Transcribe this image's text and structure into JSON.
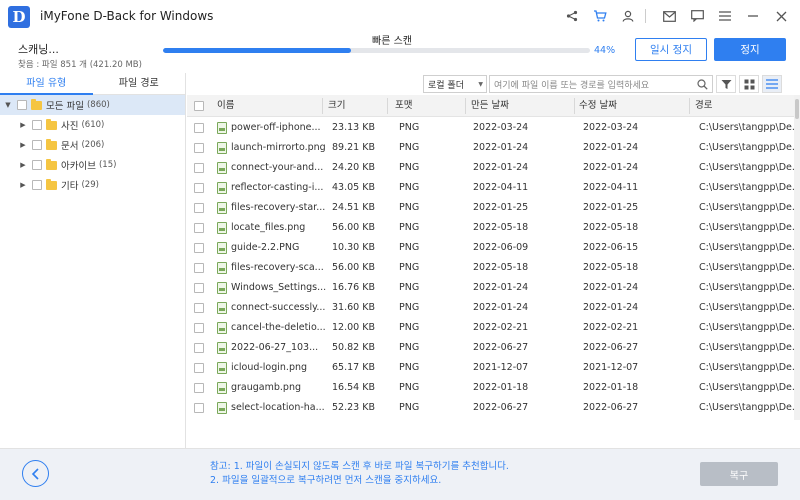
{
  "app": {
    "logo_letter": "D",
    "title": "iMyFone D-Back for Windows"
  },
  "titlebar_icons": [
    "share-icon",
    "cart-icon",
    "user-icon",
    "mail-icon",
    "feedback-icon",
    "menu-icon",
    "minimize-icon",
    "close-icon"
  ],
  "progress": {
    "status": "스캐닝...",
    "found": "찾음 : 파일 851 개 (421.20 MB)",
    "mode": "빠른 스캔",
    "percent_text": "44%",
    "percent": 44,
    "pause_label": "일시 정지",
    "stop_label": "정지"
  },
  "left": {
    "tabs": [
      "파일 유형",
      "파일 경로"
    ],
    "tree": [
      {
        "label": "모든 파일",
        "count": "(860)",
        "selected": true,
        "depth": 0
      },
      {
        "label": "사진",
        "count": "(610)",
        "selected": false,
        "depth": 1
      },
      {
        "label": "문서",
        "count": "(206)",
        "selected": false,
        "depth": 1
      },
      {
        "label": "아카이브",
        "count": "(15)",
        "selected": false,
        "depth": 1
      },
      {
        "label": "기타",
        "count": "(29)",
        "selected": false,
        "depth": 1
      }
    ]
  },
  "filter": {
    "location": "로컬 폴더",
    "search_placeholder": "여기에 파일 이름 또는 경로를 입력하세요"
  },
  "table": {
    "columns": [
      "이름",
      "크기",
      "포맷",
      "만든 날짜",
      "수정 날짜",
      "경로"
    ],
    "rows": [
      [
        "power-off-iphone...",
        "23.13 KB",
        "PNG",
        "2022-03-24",
        "2022-03-24",
        "C:\\Users\\tangpp\\De..."
      ],
      [
        "launch-mirrorto.png",
        "89.21 KB",
        "PNG",
        "2022-01-24",
        "2022-01-24",
        "C:\\Users\\tangpp\\De..."
      ],
      [
        "connect-your-and...",
        "24.20 KB",
        "PNG",
        "2022-01-24",
        "2022-01-24",
        "C:\\Users\\tangpp\\De..."
      ],
      [
        "reflector-casting-i...",
        "43.05 KB",
        "PNG",
        "2022-04-11",
        "2022-04-11",
        "C:\\Users\\tangpp\\De..."
      ],
      [
        "files-recovery-star...",
        "24.51 KB",
        "PNG",
        "2022-01-25",
        "2022-01-25",
        "C:\\Users\\tangpp\\De..."
      ],
      [
        "locate_files.png",
        "56.00 KB",
        "PNG",
        "2022-05-18",
        "2022-05-18",
        "C:\\Users\\tangpp\\De..."
      ],
      [
        "guide-2.2.PNG",
        "10.30 KB",
        "PNG",
        "2022-06-09",
        "2022-06-15",
        "C:\\Users\\tangpp\\De..."
      ],
      [
        "files-recovery-sca...",
        "56.00 KB",
        "PNG",
        "2022-05-18",
        "2022-05-18",
        "C:\\Users\\tangpp\\De..."
      ],
      [
        "Windows_Settings...",
        "16.76 KB",
        "PNG",
        "2022-01-24",
        "2022-01-24",
        "C:\\Users\\tangpp\\De..."
      ],
      [
        "connect-successly...",
        "31.60 KB",
        "PNG",
        "2022-01-24",
        "2022-01-24",
        "C:\\Users\\tangpp\\De..."
      ],
      [
        "cancel-the-deletio...",
        "12.00 KB",
        "PNG",
        "2022-02-21",
        "2022-02-21",
        "C:\\Users\\tangpp\\De..."
      ],
      [
        "2022-06-27_103...",
        "50.82 KB",
        "PNG",
        "2022-06-27",
        "2022-06-27",
        "C:\\Users\\tangpp\\De..."
      ],
      [
        "icloud-login.png",
        "65.17 KB",
        "PNG",
        "2021-12-07",
        "2021-12-07",
        "C:\\Users\\tangpp\\De..."
      ],
      [
        "graugamb.png",
        "16.54 KB",
        "PNG",
        "2022-01-18",
        "2022-01-18",
        "C:\\Users\\tangpp\\De..."
      ],
      [
        "select-location-ha...",
        "52.23 KB",
        "PNG",
        "2022-06-27",
        "2022-06-27",
        "C:\\Users\\tangpp\\De..."
      ]
    ]
  },
  "bottom": {
    "tip_line1": "참고: 1. 파일이 손실되지 않도록 스캔 후 바로 파일 복구하기를 추천합니다.",
    "tip_line2": "2. 파일을 일괄적으로 복구하려면 먼저 스캔을 중지하세요.",
    "recover_label": "복구"
  },
  "colors": {
    "accent": "#2f7ff0",
    "folder": "#f5c542",
    "disabled": "#b8bec6"
  }
}
